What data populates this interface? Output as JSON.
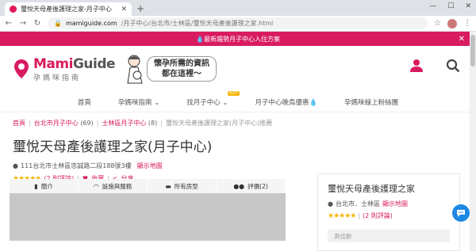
{
  "browser": {
    "tab_title": "璽悅天母產後護理之家-月子中心",
    "url_domain": "mamiguide.com",
    "url_path": "/月子中心/台北市/士林區/璽悅天母產後護理之家.html"
  },
  "promo": {
    "text": "💧最新趨勢月子中心入住方案"
  },
  "brand": {
    "name_a": "Mami",
    "name_b": "Guide",
    "sub": "孕媽咪指南",
    "tagline_1": "懷孕所需的資訊",
    "tagline_2": "都在這裡～",
    "accent": "#d81b60"
  },
  "nav": {
    "items": [
      "首頁",
      "孕媽咪指南",
      "找月子中心",
      "月子中心晚鳥優惠💧",
      "孕媽咪線上粉絲團"
    ],
    "hot_badge": "HOT"
  },
  "breadcrumb": {
    "home": "首頁",
    "city": "台北市月子中心",
    "city_count": "(69)",
    "district": "士林區月子中心",
    "district_count": "(8)",
    "current": "璽悅天母產後護理之家(月子中心)推薦"
  },
  "listing": {
    "title": "璽悅天母產後護理之家(月子中心)",
    "address": "111台北市士林區忠誠路二段188號3樓",
    "map_link": "顯示地圖",
    "stars": "★★★★★",
    "reviews": "(2 則評論)",
    "favorite": "收藏",
    "share": "分享"
  },
  "content_tabs": [
    {
      "icon": "book-icon",
      "label": "簡介"
    },
    {
      "icon": "wifi-icon",
      "label": "設施與服務"
    },
    {
      "icon": "bed-icon",
      "label": "所有房型"
    },
    {
      "icon": "users-icon",
      "label": "評價(2)"
    }
  ],
  "sidecard": {
    "title": "璽悅天母產後護理之家",
    "location": "台北市．士林區",
    "map_link": "顯示地圖",
    "reviews": "(2 則評論)",
    "field_placeholder": "高佳齡"
  }
}
